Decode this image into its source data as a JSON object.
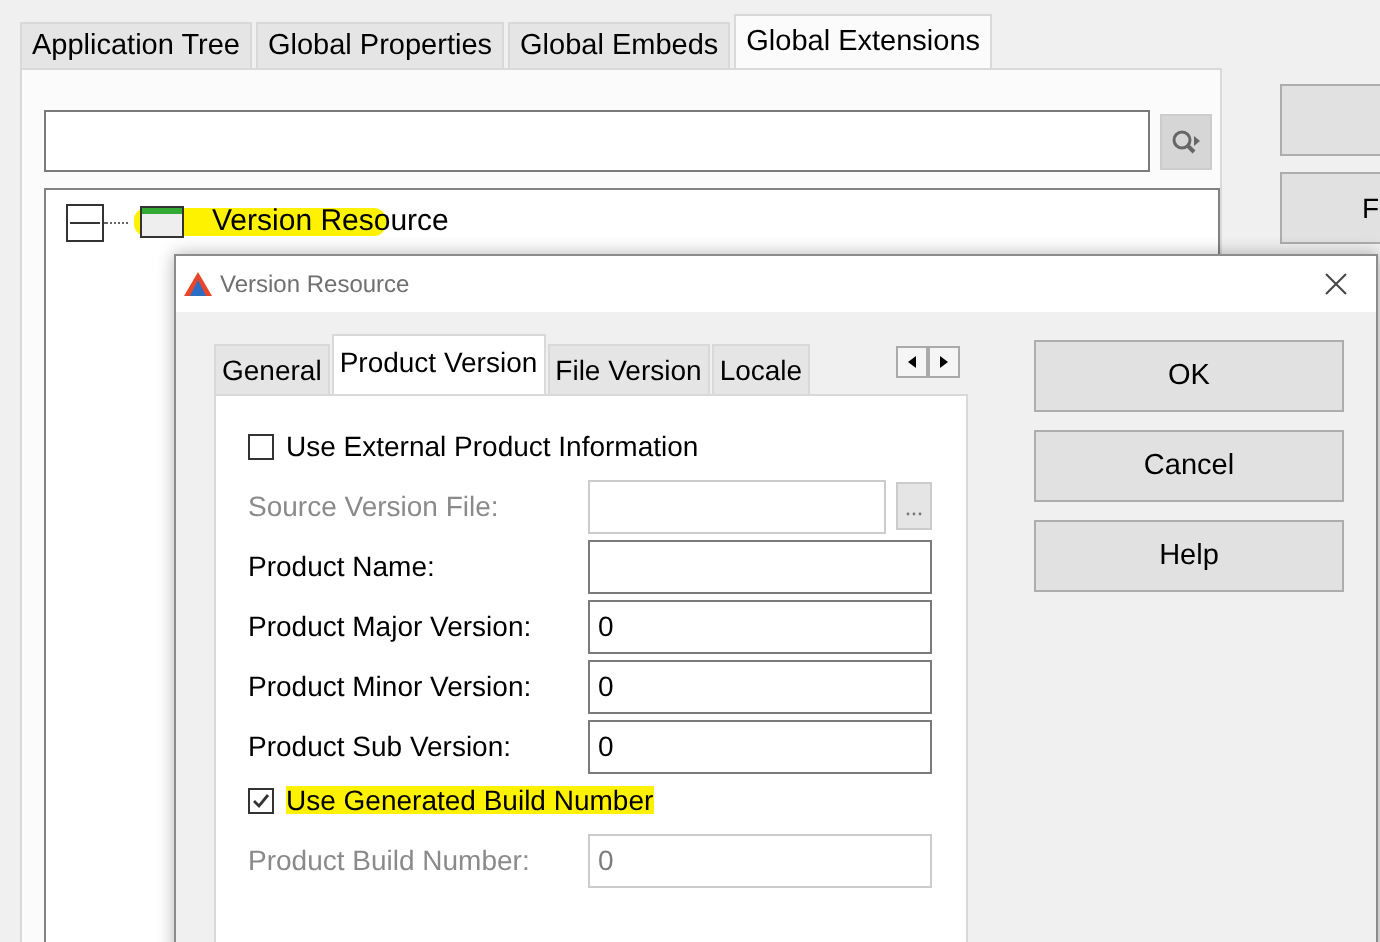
{
  "main_window": {
    "tabs": [
      {
        "label": "Application Tree",
        "selected": false
      },
      {
        "label": "Global Properties",
        "selected": false
      },
      {
        "label": "Global Embeds",
        "selected": false
      },
      {
        "label": "Global Extensions",
        "selected": true
      }
    ],
    "tree": [
      {
        "label": "Version Resource",
        "expanded": true,
        "highlighted": true
      }
    ],
    "side_buttons": [
      {
        "kind": "blank"
      },
      {
        "kind": "labeled",
        "label": "F"
      }
    ]
  },
  "dialog": {
    "title": "Version Resource",
    "tabs": [
      {
        "label": "General",
        "selected": false
      },
      {
        "label": "Product Version",
        "selected": true
      },
      {
        "label": "File Version",
        "selected": false
      },
      {
        "label": "Locale",
        "selected": false
      }
    ],
    "fields": [
      {
        "kind": "checkbox",
        "label": "Use External Product Information",
        "checked": false,
        "highlighted": false
      },
      {
        "kind": "file",
        "label": "Source Version File:",
        "disabled": true
      },
      {
        "kind": "text",
        "label": "Product Name:",
        "disabled": false
      },
      {
        "kind": "text",
        "label": "Product Major Version:",
        "value": "0",
        "disabled": false
      },
      {
        "kind": "text",
        "label": "Product Minor Version:",
        "value": "0",
        "disabled": false
      },
      {
        "kind": "text",
        "label": "Product Sub Version:",
        "value": "0",
        "disabled": false
      },
      {
        "kind": "checkbox",
        "label": "Use Generated Build Number",
        "checked": true,
        "highlighted": true
      },
      {
        "kind": "text",
        "label": "Product Build Number:",
        "value": "0",
        "disabled": true
      }
    ],
    "buttons": [
      {
        "label": "OK"
      },
      {
        "label": "Cancel"
      },
      {
        "label": "Help"
      }
    ]
  }
}
